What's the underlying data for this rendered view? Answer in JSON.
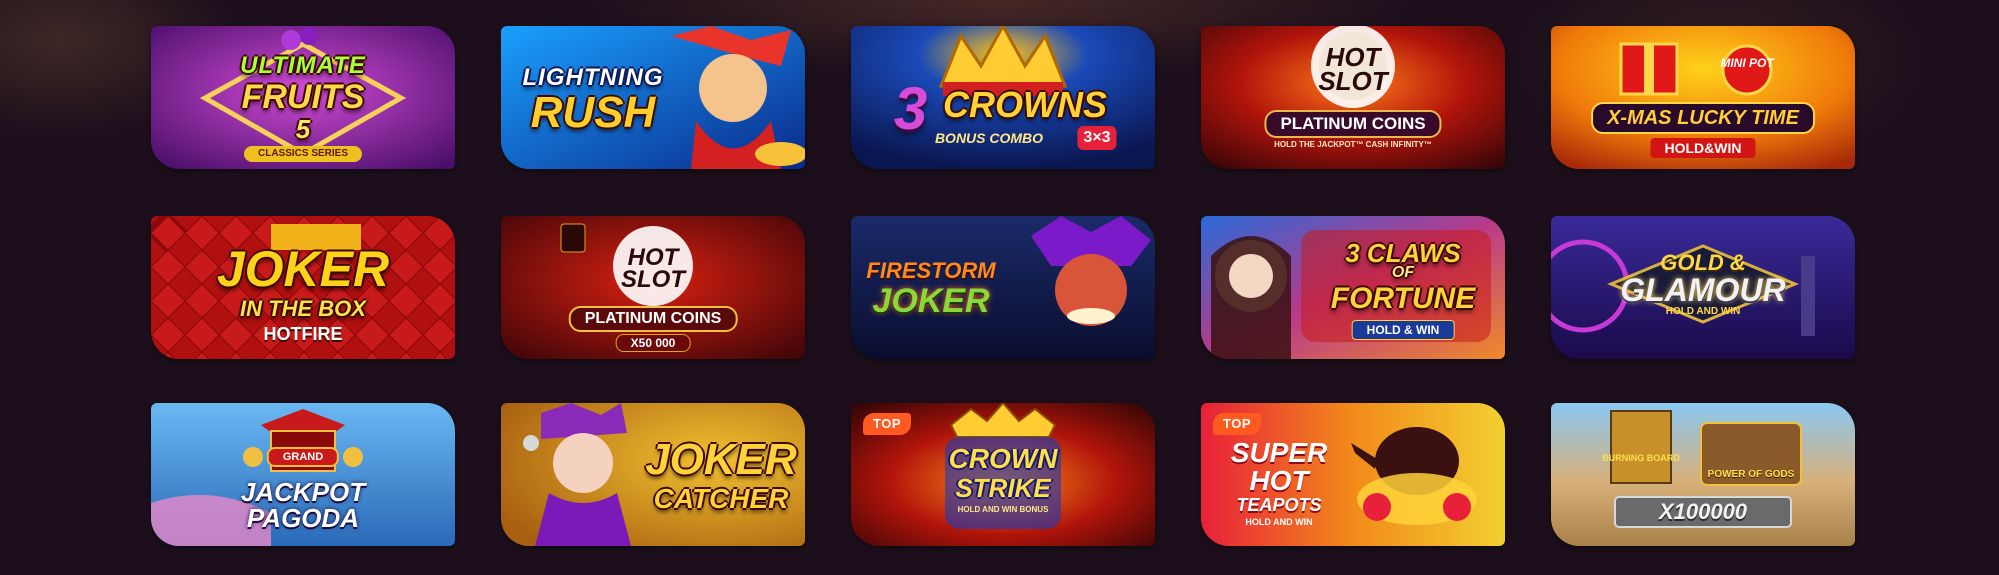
{
  "games": [
    {
      "title_1": "Ultimate",
      "title_2": "Fruits",
      "title_3": "5",
      "subtitle": "Classics Series",
      "badge": ""
    },
    {
      "title_1": "Lightning",
      "title_2": "Rush",
      "title_3": "",
      "subtitle": "",
      "badge": ""
    },
    {
      "title_1": "3",
      "title_2": "Crowns",
      "title_3": "Bonus Combo",
      "subtitle": "3×3",
      "badge": ""
    },
    {
      "title_1": "Hot",
      "title_2": "Slot",
      "title_3": "Platinum Coins",
      "subtitle": "Hold the Jackpot™ Cash Infinity™",
      "badge": ""
    },
    {
      "title_1": "Mini Pot",
      "title_2": "X-Mas Lucky Time",
      "title_3": "Hold&Win",
      "subtitle": "",
      "badge": ""
    },
    {
      "title_1": "Joker",
      "title_2": "In the Box",
      "title_3": "Hotfire",
      "subtitle": "",
      "badge": ""
    },
    {
      "title_1": "Hot",
      "title_2": "Slot",
      "title_3": "Platinum Coins",
      "subtitle": "x50 000",
      "badge": ""
    },
    {
      "title_1": "Firestorm",
      "title_2": "Joker",
      "title_3": "",
      "subtitle": "",
      "badge": ""
    },
    {
      "title_1": "3 Claws",
      "title_2": "of",
      "title_3": "Fortune",
      "subtitle": "Hold & Win",
      "badge": ""
    },
    {
      "title_1": "Gold &",
      "title_2": "Glamour",
      "title_3": "Hold and Win",
      "subtitle": "",
      "badge": ""
    },
    {
      "title_1": "Grand",
      "title_2": "Jackpot",
      "title_3": "Pagoda",
      "subtitle": "",
      "badge": ""
    },
    {
      "title_1": "Joker",
      "title_2": "Catcher",
      "title_3": "",
      "subtitle": "",
      "badge": ""
    },
    {
      "title_1": "Crown",
      "title_2": "Strike",
      "title_3": "Hold and Win Bonus",
      "subtitle": "",
      "badge": "TOP"
    },
    {
      "title_1": "Super",
      "title_2": "Hot",
      "title_3": "Teapots",
      "subtitle": "Hold and Win",
      "badge": "TOP"
    },
    {
      "title_1": "Burning Board",
      "title_2": "Power of Gods",
      "title_3": "x100000",
      "subtitle": "",
      "badge": ""
    }
  ],
  "colors": {
    "page_bg": "#1c0f1b",
    "badge": "#ff5a1f"
  }
}
